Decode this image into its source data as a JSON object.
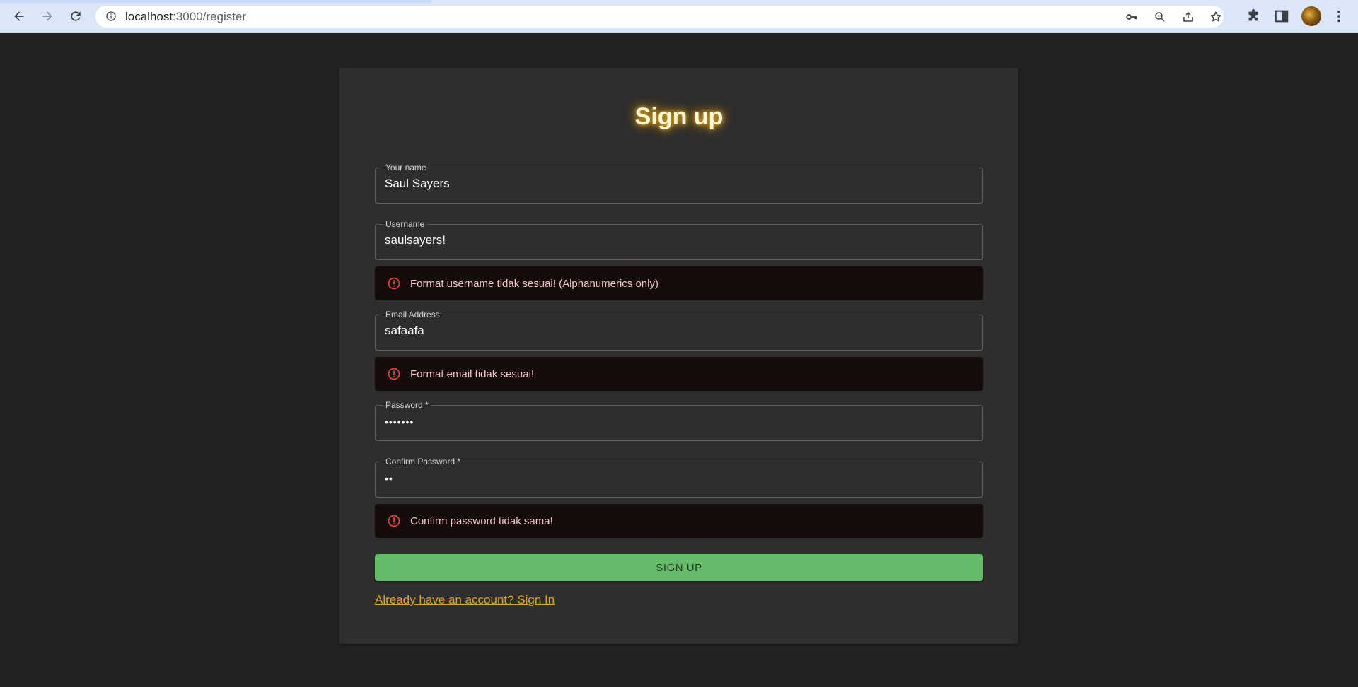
{
  "browser": {
    "url_host": "localhost",
    "url_path": ":3000/register"
  },
  "icons": {
    "back": "arrow-left-icon",
    "forward": "arrow-right-icon",
    "reload": "reload-icon",
    "info": "info-icon",
    "key": "key-icon",
    "zoom": "zoom-out-icon",
    "share": "share-icon",
    "star": "star-icon",
    "extensions": "puzzle-icon",
    "sidepanel": "side-panel-icon",
    "menu": "kebab-menu-icon",
    "error": "error-circle-icon"
  },
  "form": {
    "title": "Sign up",
    "fields": [
      {
        "label": "Your name",
        "value": "Saul Sayers"
      },
      {
        "label": "Username",
        "value": "saulsayers!"
      },
      {
        "label": "Email Address",
        "value": "safaafa"
      },
      {
        "label": "Password *",
        "value": "•••••••"
      },
      {
        "label": "Confirm Password *",
        "value": "••"
      }
    ],
    "errors": {
      "username": "Format username tidak sesuai! (Alphanumerics only)",
      "email": "Format email tidak sesuai!",
      "confirm": "Confirm password tidak sama!"
    },
    "submit_label": "SIGN UP",
    "signin_link": "Already have an account? Sign In"
  },
  "colors": {
    "page_bg": "#222222",
    "card_bg": "#2e2e2e",
    "accent_gold": "#d9a52a",
    "button_green": "#66bb6a",
    "error_red": "#f44336"
  }
}
